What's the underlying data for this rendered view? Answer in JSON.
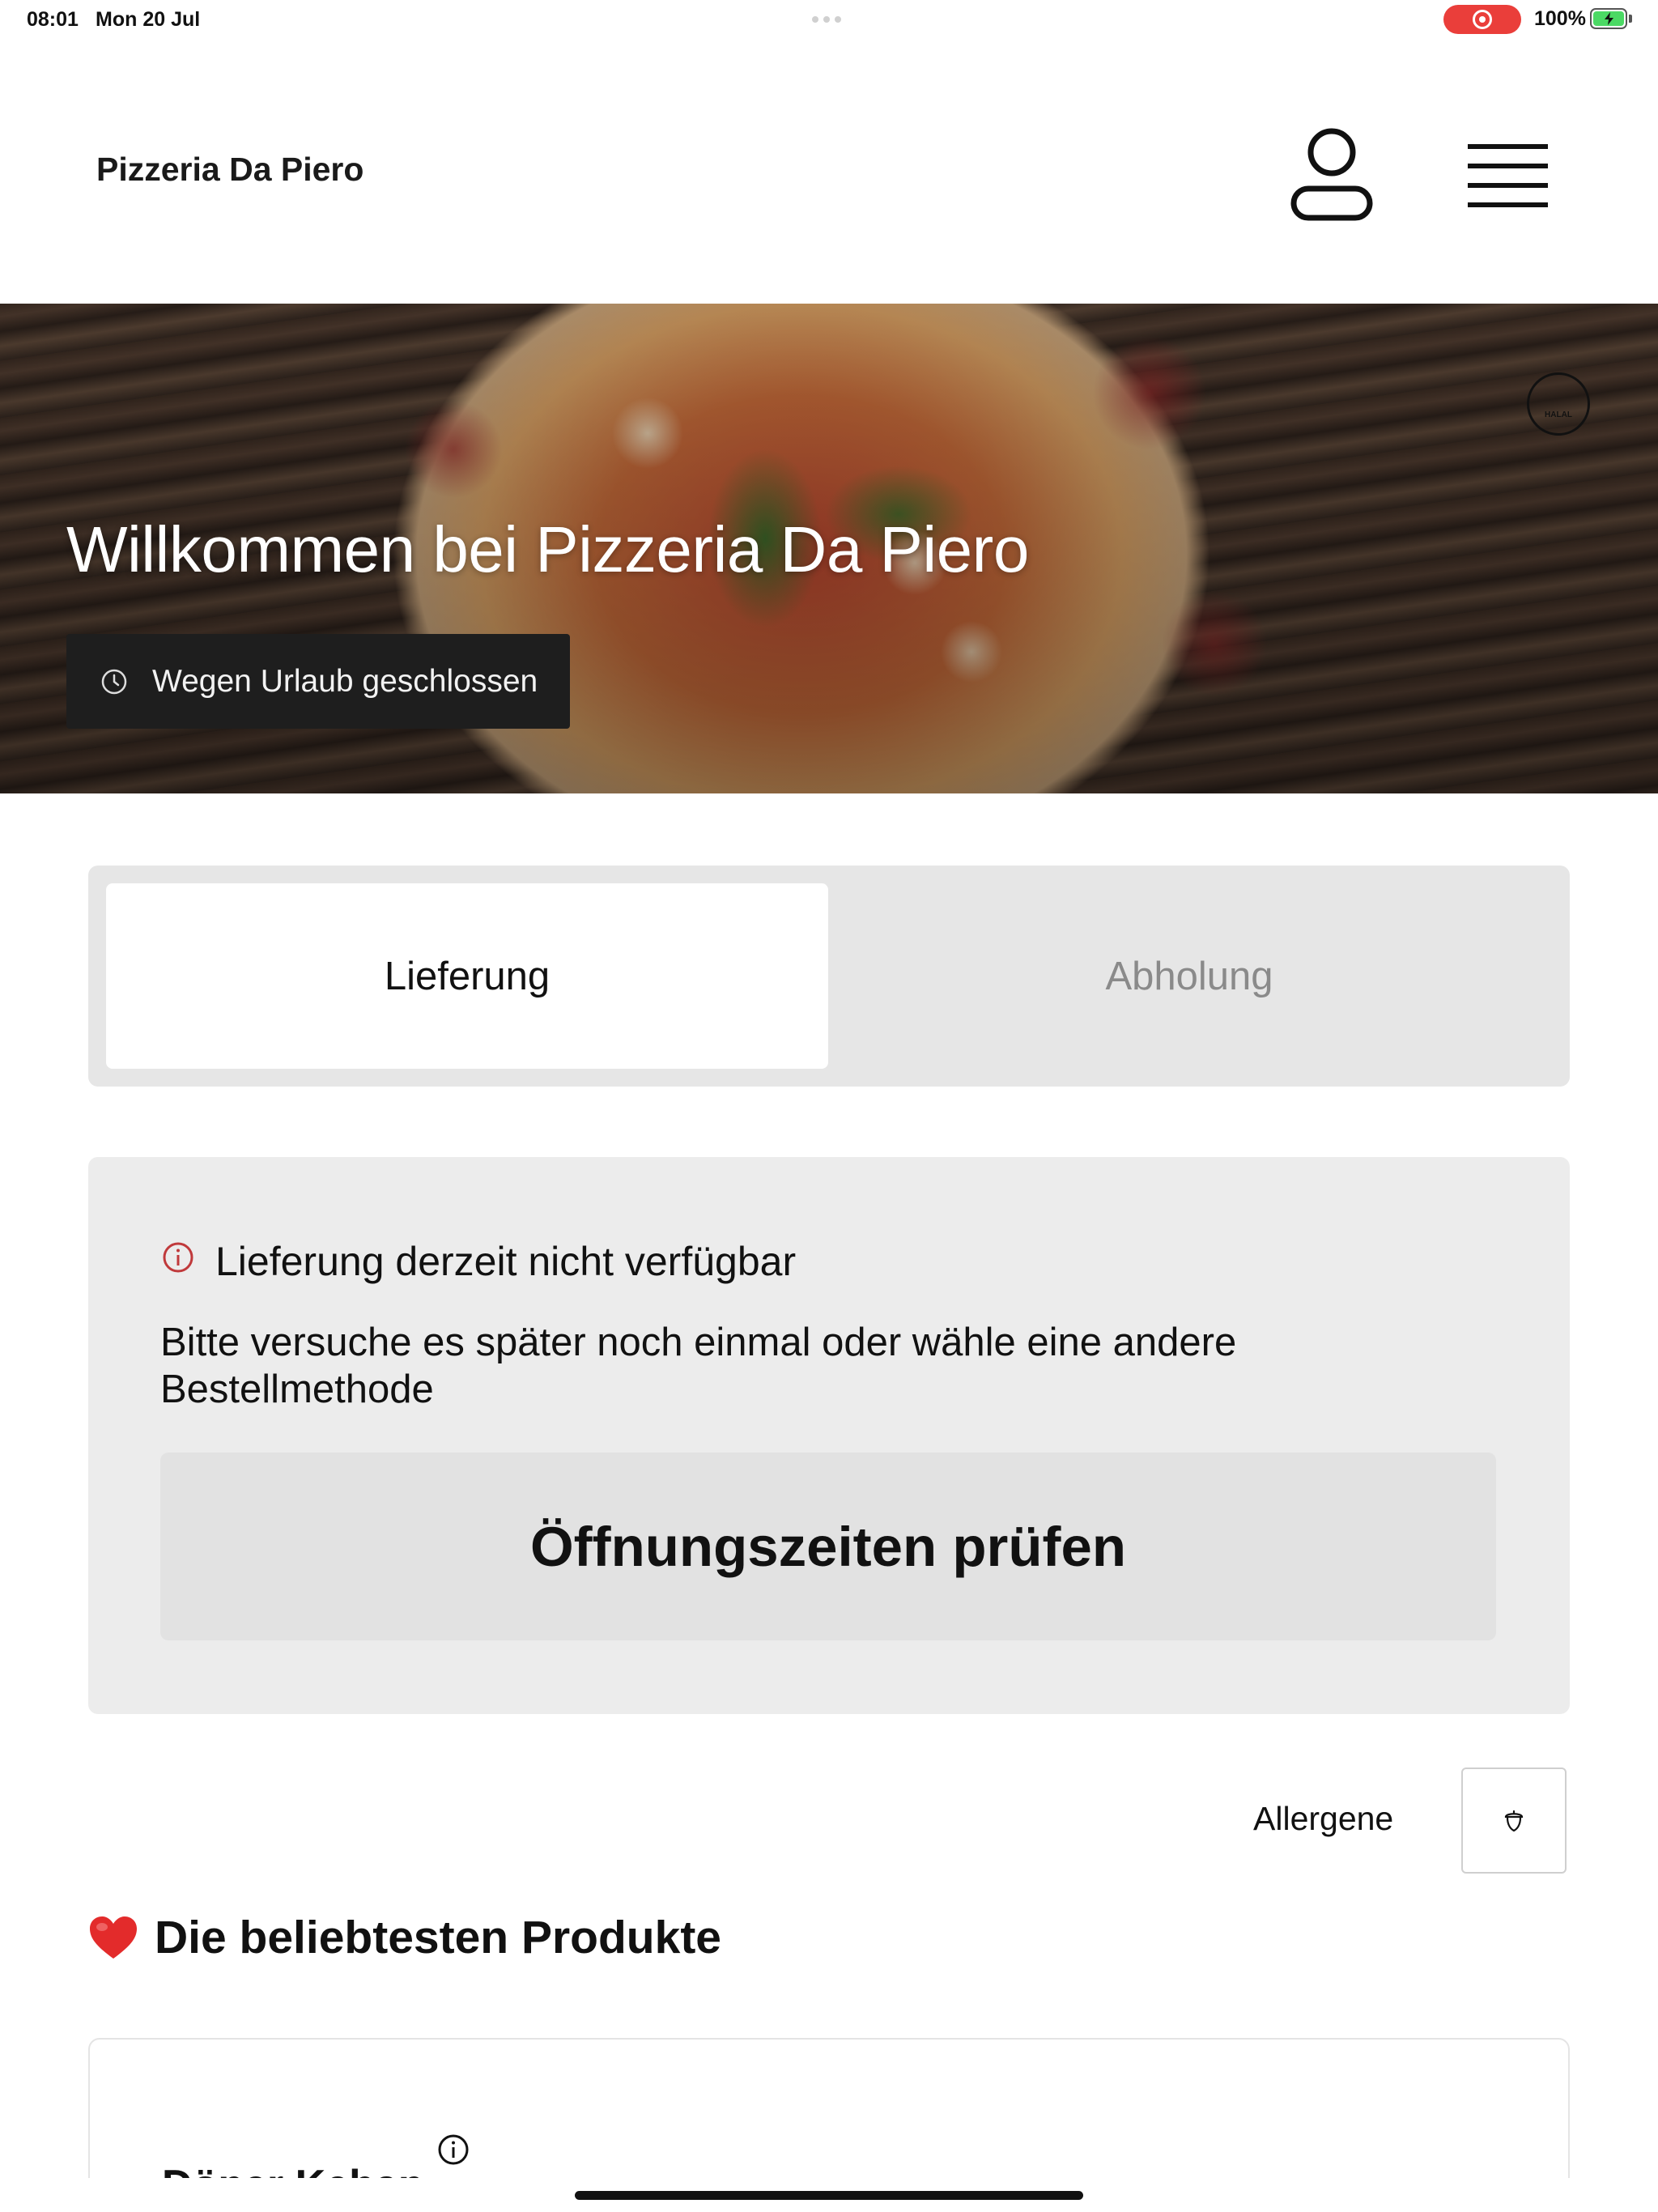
{
  "status_bar": {
    "time": "08:01",
    "date": "Mon 20 Jul",
    "battery_percent": "100%",
    "battery_color": "#4bd964",
    "recording_color": "#ea3e3a"
  },
  "header": {
    "brand": "Pizzeria Da Piero",
    "user_icon": "user-icon",
    "menu_icon": "hamburger-menu-icon"
  },
  "hero": {
    "title": "Willkommen bei Pizzeria Da Piero",
    "closed_text": "Wegen Urlaub geschlossen",
    "badge_text": "HALAL"
  },
  "order_method": {
    "options": [
      {
        "label": "Lieferung",
        "active": true
      },
      {
        "label": "Abholung",
        "active": false
      }
    ]
  },
  "notice": {
    "title": "Lieferung derzeit nicht verfügbar",
    "message": "Bitte versuche es später noch einmal oder wähle eine andere Bestellmethode",
    "button_label": "Öffnungszeiten prüfen",
    "icon_color": "#c0393b"
  },
  "allergens": {
    "label": "Allergene"
  },
  "popular": {
    "title": "Die beliebtesten Produkte",
    "products": [
      {
        "name": "Döner Kebap"
      }
    ]
  }
}
